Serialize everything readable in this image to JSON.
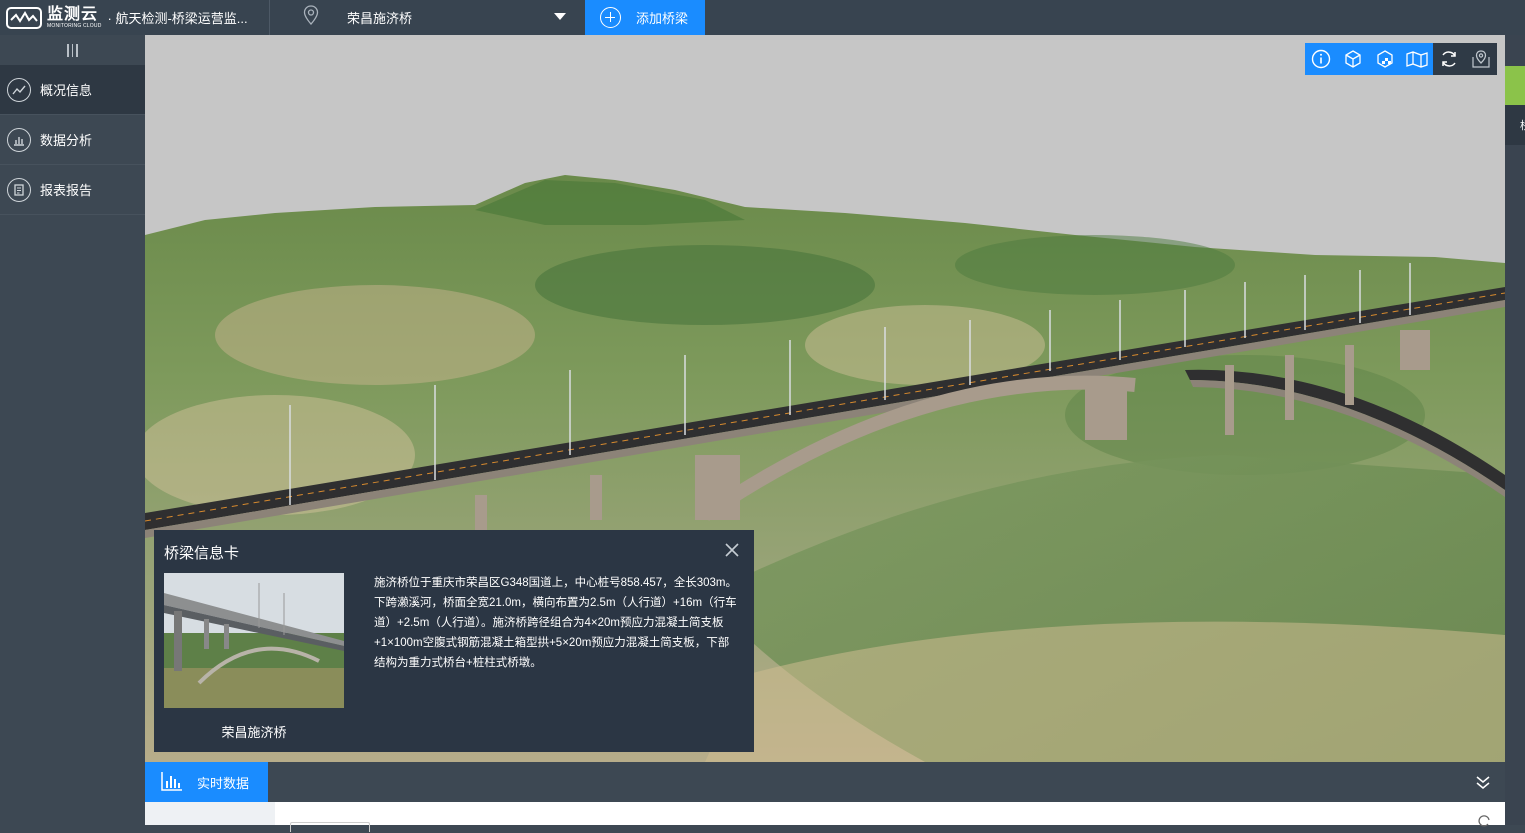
{
  "header": {
    "logo_cn": "监测云",
    "logo_en": "MONITORING CLOUD",
    "app_title": "· 航天检测-桥梁运营监...",
    "selected_bridge": "荣昌施济桥",
    "add_button_label": "添加桥梁"
  },
  "sidebar": {
    "items": [
      {
        "label": "概况信息",
        "icon": "overview-icon",
        "active": true
      },
      {
        "label": "数据分析",
        "icon": "chart-icon",
        "active": false
      },
      {
        "label": "报表报告",
        "icon": "report-icon",
        "active": false
      }
    ]
  },
  "toolbar": {
    "buttons": [
      "info-icon",
      "cube-icon",
      "texture-cube-icon",
      "map-icon",
      "refresh-icon",
      "location-map-icon"
    ]
  },
  "right_strip": {
    "tab_text": "桥"
  },
  "info_card": {
    "title": "桥梁信息卡",
    "bridge_name": "荣昌施济桥",
    "description": "施济桥位于重庆市荣昌区G348国道上，中心桩号858.457，全长303m。下跨濑溪河，桥面全宽21.0m，横向布置为2.5m（人行道）+16m（行车道）+2.5m（人行道）。施济桥跨径组合为4×20m预应力混凝土简支板+1×100m空腹式钢筋混凝土箱型拱+5×20m预应力混凝土简支板，下部结构为重力式桥台+桩柱式桥墩。"
  },
  "bottom": {
    "realtime_tab_label": "实时数据"
  },
  "colors": {
    "accent": "#1a8cff",
    "sidebar_bg": "#3d4853",
    "card_bg": "#2b3644",
    "status_green": "#8bc34a"
  }
}
